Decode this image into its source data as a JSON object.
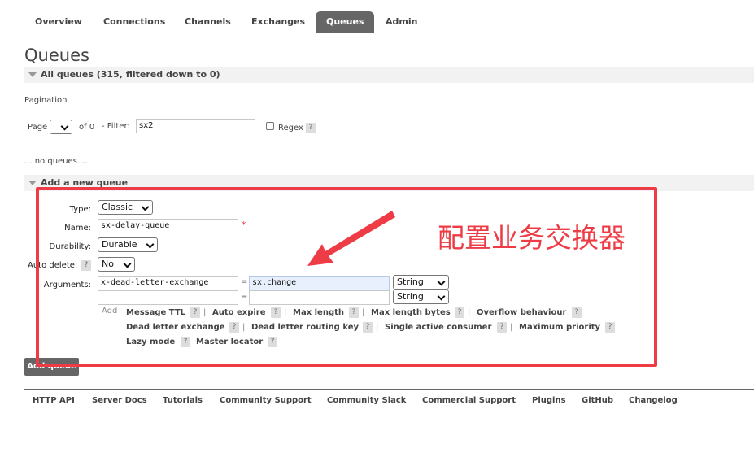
{
  "tabs": [
    "Overview",
    "Connections",
    "Channels",
    "Exchanges",
    "Queues",
    "Admin"
  ],
  "active_tab": "Queues",
  "page_title": "Queues",
  "all_queues_header": "All queues (315, filtered down to 0)",
  "pagination": {
    "title": "Pagination",
    "page_label": "Page",
    "of_label": "of 0",
    "filter_label": "- Filter:",
    "filter_value": "sx2",
    "regex_label": "Regex",
    "help": "?"
  },
  "no_queues": "... no queues ...",
  "add_queue_header": "Add a new queue",
  "form": {
    "type_label": "Type:",
    "type_value": "Classic",
    "name_label": "Name:",
    "name_value": "sx-delay-queue",
    "required_mark": "*",
    "durability_label": "Durability:",
    "durability_value": "Durable",
    "auto_delete_label": "Auto delete:",
    "auto_delete_help": "?",
    "auto_delete_value": "No",
    "arguments_label": "Arguments:",
    "arg1_key": "x-dead-letter-exchange",
    "arg1_eq": "=",
    "arg1_value": "sx.change",
    "arg1_type": "String",
    "arg2_key": "",
    "arg2_eq": "=",
    "arg2_value": "",
    "arg2_type": "String",
    "add_label": "Add",
    "shortcuts": [
      "Message TTL",
      "Auto expire",
      "Max length",
      "Max length bytes",
      "Overflow behaviour",
      "Dead letter exchange",
      "Dead letter routing key",
      "Single active consumer",
      "Maximum priority",
      "Lazy mode",
      "Master locator"
    ],
    "help": "?",
    "separator": "|"
  },
  "add_button": "Add queue",
  "footer": [
    "HTTP API",
    "Server Docs",
    "Tutorials",
    "Community Support",
    "Community Slack",
    "Commercial Support",
    "Plugins",
    "GitHub",
    "Changelog"
  ],
  "annotation": "配置业务交换器",
  "colors": {
    "annotation": "#ee3c46",
    "tab_active": "#666666",
    "button": "#666666"
  }
}
